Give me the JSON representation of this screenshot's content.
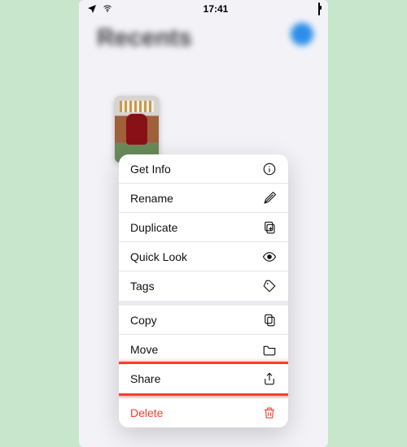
{
  "status": {
    "time": "17:41"
  },
  "page": {
    "title": "Recents"
  },
  "menu": {
    "groups": [
      {
        "items": [
          {
            "key": "getinfo",
            "label": "Get Info",
            "icon": "info-icon"
          },
          {
            "key": "rename",
            "label": "Rename",
            "icon": "pencil-icon"
          },
          {
            "key": "duplicate",
            "label": "Duplicate",
            "icon": "duplicate-icon"
          },
          {
            "key": "quicklook",
            "label": "Quick Look",
            "icon": "eye-icon"
          },
          {
            "key": "tags",
            "label": "Tags",
            "icon": "tag-icon"
          }
        ]
      },
      {
        "items": [
          {
            "key": "copy",
            "label": "Copy",
            "icon": "copy-icon"
          },
          {
            "key": "move",
            "label": "Move",
            "icon": "folder-icon"
          },
          {
            "key": "share",
            "label": "Share",
            "icon": "share-icon",
            "highlighted": true
          }
        ]
      },
      {
        "items": [
          {
            "key": "delete",
            "label": "Delete",
            "icon": "trash-icon",
            "destructive": true
          }
        ]
      }
    ]
  },
  "colors": {
    "destructive": "#ff3b30",
    "accent": "#0a7de6"
  }
}
